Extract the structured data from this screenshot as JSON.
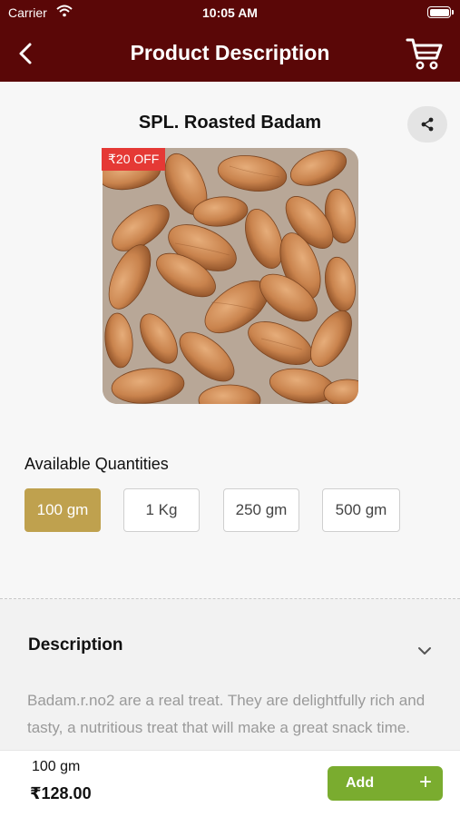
{
  "status_bar": {
    "carrier": "Carrier",
    "time": "10:05 AM"
  },
  "nav": {
    "title": "Product Description"
  },
  "product": {
    "title": "SPL. Roasted Badam",
    "discount_badge": "₹20 OFF"
  },
  "quantities": {
    "label": "Available Quantities",
    "options": [
      "100 gm",
      "1 Kg",
      "250 gm",
      "500 gm"
    ],
    "selected": "100 gm"
  },
  "description": {
    "title": "Description",
    "text": "Badam.r.no2 are a real treat. They are delightfully rich and tasty, a nutritious treat that will make a great snack time."
  },
  "bottom_bar": {
    "selected_qty": "100 gm",
    "price": "₹128.00",
    "add_label": "Add",
    "add_icon": "+"
  },
  "colors": {
    "header_bg": "#5a0707",
    "selected_qty": "#bfa14e",
    "add_button": "#7aac2f",
    "discount_badge": "#e53935"
  }
}
